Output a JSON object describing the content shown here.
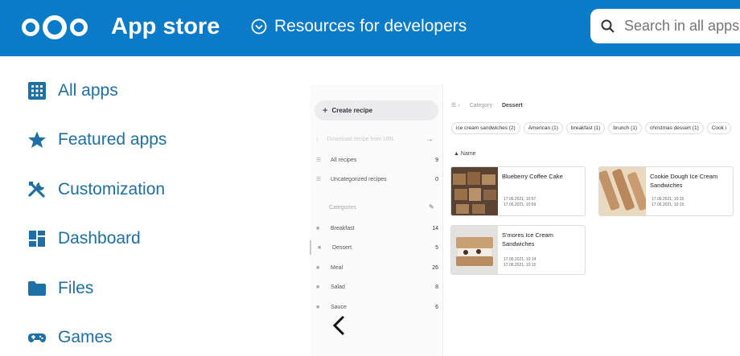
{
  "header": {
    "logo_icon": "nextcloud-logo-icon",
    "title": "App store",
    "resources_icon": "chevron-circle-down-icon",
    "resources_label": "Resources for developers",
    "search_icon": "search-icon",
    "search_placeholder": "Search in all apps",
    "bg_color": "#0a7bc9"
  },
  "nav": {
    "items": [
      {
        "icon": "grid-icon",
        "label": "All apps"
      },
      {
        "icon": "star-icon",
        "label": "Featured apps"
      },
      {
        "icon": "tools-icon",
        "label": "Customization"
      },
      {
        "icon": "dashboard-icon",
        "label": "Dashboard"
      },
      {
        "icon": "folder-icon",
        "label": "Files"
      },
      {
        "icon": "gamepad-icon",
        "label": "Games"
      }
    ],
    "text_color": "#1d6fa5"
  },
  "preview": {
    "sidebar": {
      "create_label": "Create recipe",
      "download_placeholder": "Download recipe from URL",
      "all_recipes": {
        "label": "All recipes",
        "count": "9"
      },
      "uncategorized": {
        "label": "Uncategorized recipes",
        "count": "0"
      },
      "categories_header": "Categories",
      "categories": [
        {
          "label": "Breakfast",
          "count": "14"
        },
        {
          "label": "Dessert",
          "count": "5"
        },
        {
          "label": "Meal",
          "count": "26"
        },
        {
          "label": "Salad",
          "count": "8"
        },
        {
          "label": "Sauce",
          "count": "6"
        }
      ]
    },
    "main": {
      "breadcrumb": {
        "category": "Category",
        "current": "Dessert"
      },
      "tags": [
        "ice cream sandwiches (2)",
        "American (1)",
        "breakfast (1)",
        "brunch (1)",
        "christmas dessert (1)",
        "Cook i"
      ],
      "sort_label": "Name",
      "cards": [
        {
          "title": "Blueberry Coffee Cake",
          "created": "17.06.2021, 10:57",
          "modified": "17.06.2021, 10:59"
        },
        {
          "title": "Cookie Dough Ice Cream Sandwiches",
          "created": "17.06.2021, 10:15",
          "modified": "17.06.2021, 10:15"
        },
        {
          "title": "S'mores Ice Cream Sandwiches",
          "created": "17.06.2021, 10:14",
          "modified": "17.06.2021, 10:15"
        }
      ]
    }
  }
}
